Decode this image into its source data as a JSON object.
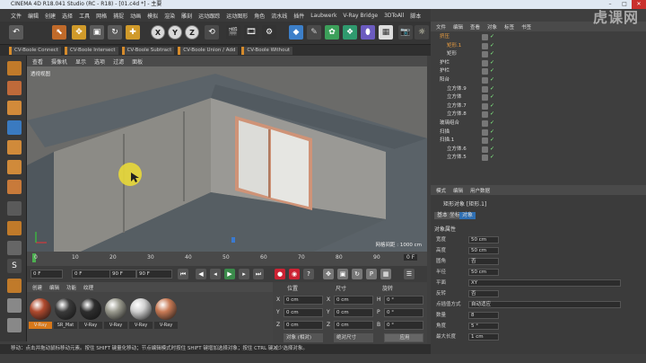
{
  "window": {
    "title": "CINEMA 4D R18.041 Studio (RC - R18) - [01.c4d *] - 主要"
  },
  "menubar": {
    "items": [
      "文件",
      "编辑",
      "创建",
      "选择",
      "工具",
      "网格",
      "捕捉",
      "动画",
      "模拟",
      "渲染",
      "雕刻",
      "运动跟踪",
      "运动图形",
      "角色",
      "流水线",
      "插件",
      "Laubwerk",
      "V-Ray Bridge",
      "3DToAll",
      "脚本"
    ]
  },
  "toolbar": {
    "axis_x": "X",
    "axis_y": "Y",
    "axis_z": "Z"
  },
  "bool_tabs": [
    "CV-Boole Connect",
    "CV-Boole Intersect",
    "CV-Boole Subtract",
    "CV-Boole Union / Add",
    "CV-Boole Without"
  ],
  "viewport": {
    "menu": [
      "查看",
      "摄像机",
      "显示",
      "选项",
      "过滤",
      "面板"
    ],
    "label": "透视视图",
    "grid_spacing": "网格间距 : 1000 cm"
  },
  "timeline": {
    "ticks": [
      "0",
      "10",
      "20",
      "30",
      "40",
      "50",
      "60",
      "70",
      "80",
      "90"
    ],
    "end_label": "0 F"
  },
  "transport": {
    "start": "0 F",
    "current": "0 F",
    "max": "90 F",
    "end": "90 F"
  },
  "materials": {
    "menu": [
      "创建",
      "编辑",
      "功能",
      "纹理"
    ],
    "items": [
      {
        "label": "V-Ray",
        "color": "#b04a2e"
      },
      {
        "label": "SR_Mat",
        "color": "#3a3a3a"
      },
      {
        "label": "V-Ray",
        "color": "#2e2e2e"
      },
      {
        "label": "V-Ray",
        "color": "#9a9a8e"
      },
      {
        "label": "V-Ray",
        "color": "#d0d0d0"
      },
      {
        "label": "V-Ray",
        "color": "#c87a55"
      }
    ]
  },
  "coords": {
    "headers": [
      "位置",
      "尺寸",
      "旋转"
    ],
    "rows": [
      {
        "axis": "X",
        "pos": "0 cm",
        "size": "0 cm",
        "rot_axis": "H",
        "rot": "0 °"
      },
      {
        "axis": "Y",
        "pos": "0 cm",
        "size": "0 cm",
        "rot_axis": "P",
        "rot": "0 °"
      },
      {
        "axis": "Z",
        "pos": "0 cm",
        "size": "0 cm",
        "rot_axis": "B",
        "rot": "0 °"
      }
    ],
    "mode": "对象 (相对)",
    "size_mode": "绝对尺寸",
    "apply": "应用"
  },
  "objects": {
    "menu": [
      "文件",
      "编辑",
      "查看",
      "对象",
      "标签",
      "书签"
    ],
    "rows": [
      {
        "name": "挤压",
        "indent": 0
      },
      {
        "name": "矩形.1",
        "indent": 1
      },
      {
        "name": "矩形",
        "indent": 1
      },
      {
        "name": "护栏",
        "indent": 0
      },
      {
        "name": "护栏",
        "indent": 0
      },
      {
        "name": "阳台",
        "indent": 0
      },
      {
        "name": "立方体.9",
        "indent": 1
      },
      {
        "name": "立方体",
        "indent": 1
      },
      {
        "name": "立方体.7",
        "indent": 1
      },
      {
        "name": "立方体.8",
        "indent": 1
      },
      {
        "name": "玻璃组合",
        "indent": 0
      },
      {
        "name": "扫描",
        "indent": 0
      },
      {
        "name": "扫描.1",
        "indent": 0
      },
      {
        "name": "立方体.6",
        "indent": 1
      },
      {
        "name": "立方体.5",
        "indent": 1
      }
    ]
  },
  "attributes": {
    "menu": [
      "模式",
      "编辑",
      "用户数据"
    ],
    "title": "矩形对象 [矩形.1]",
    "tabs": [
      "基本",
      "坐标",
      "对象"
    ],
    "section": "对象属性",
    "fields": [
      {
        "label": "宽度",
        "value": "50 cm"
      },
      {
        "label": "高度",
        "value": "50 cm"
      },
      {
        "label": "圆角",
        "value": "否"
      },
      {
        "label": "半径",
        "value": "50 cm"
      },
      {
        "label": "平面",
        "value": "XY"
      },
      {
        "label": "反转",
        "value": "否"
      },
      {
        "label": "点插值方式",
        "value": "自动适应"
      },
      {
        "label": "数量",
        "value": "8"
      },
      {
        "label": "角度",
        "value": "5 °"
      },
      {
        "label": "最大长度",
        "value": "1 cm"
      }
    ]
  },
  "statusbar": {
    "text": "移动：点击并拖动鼠标移动元素。按住 SHIFT 键量化移动；节点编辑模式时按住 SHIFT 键增加选择对象；按住 CTRL 键减少选择对象。"
  },
  "watermark": "虎课网"
}
